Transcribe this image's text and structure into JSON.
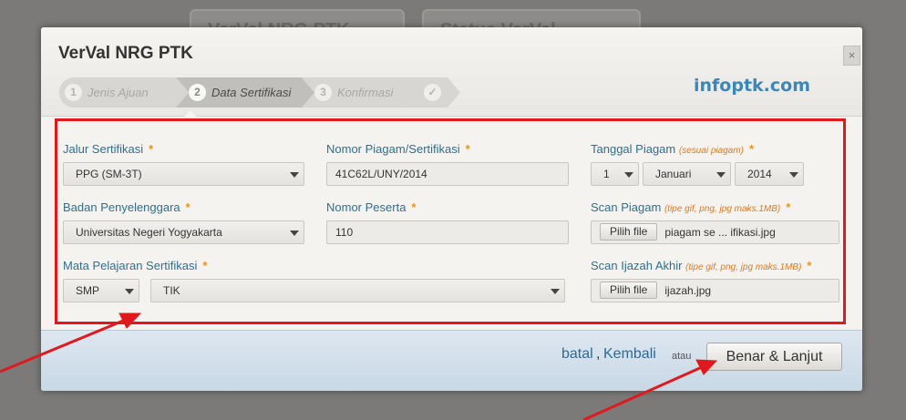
{
  "background_tabs": [
    "VerVal NRG PTK",
    "Status VerVal"
  ],
  "modal": {
    "title": "VerVal NRG PTK",
    "close_label": "×",
    "brand": "infoptk.com",
    "steps": [
      {
        "num": "1",
        "label": "Jenis Ajuan"
      },
      {
        "num": "2",
        "label": "Data Sertifikasi"
      },
      {
        "num": "3",
        "label": "Konfirmasi"
      },
      {
        "num": "✓",
        "label": ""
      }
    ],
    "active_step": 2
  },
  "form": {
    "jalur": {
      "label": "Jalur Sertifikasi",
      "value": "PPG (SM-3T)"
    },
    "nomor_piagam": {
      "label": "Nomor Piagam/Sertifikasi",
      "value": "41C62L/UNY/2014"
    },
    "tanggal": {
      "label": "Tanggal Piagam",
      "hint": "(sesuai piagam)",
      "day": "1",
      "month": "Januari",
      "year": "2014"
    },
    "badan": {
      "label": "Badan Penyelenggara",
      "value": "Universitas Negeri Yogyakarta"
    },
    "nomor_peserta": {
      "label": "Nomor Peserta",
      "value": "110"
    },
    "scan_piagam": {
      "label": "Scan Piagam",
      "hint": "(tipe gif, png, jpg maks.1MB)",
      "button": "Pilih file",
      "file": "piagam se ... ifikasi.jpg"
    },
    "mapel": {
      "label": "Mata Pelajaran Sertifikasi",
      "level": "SMP",
      "subject": "TIK"
    },
    "scan_ijazah": {
      "label": "Scan Ijazah Akhir",
      "hint": "(tipe gif, png, jpg maks.1MB)",
      "button": "Pilih file",
      "file": "ijazah.jpg"
    },
    "required_mark": "*"
  },
  "footer": {
    "batal": "batal",
    "comma": ",",
    "kembali": "Kembali",
    "atau": "atau",
    "submit": "Benar & Lanjut"
  },
  "colors": {
    "annotation": "#e0191f",
    "link": "#2e6a94",
    "label": "#2f6f8f",
    "required": "#e89317"
  }
}
